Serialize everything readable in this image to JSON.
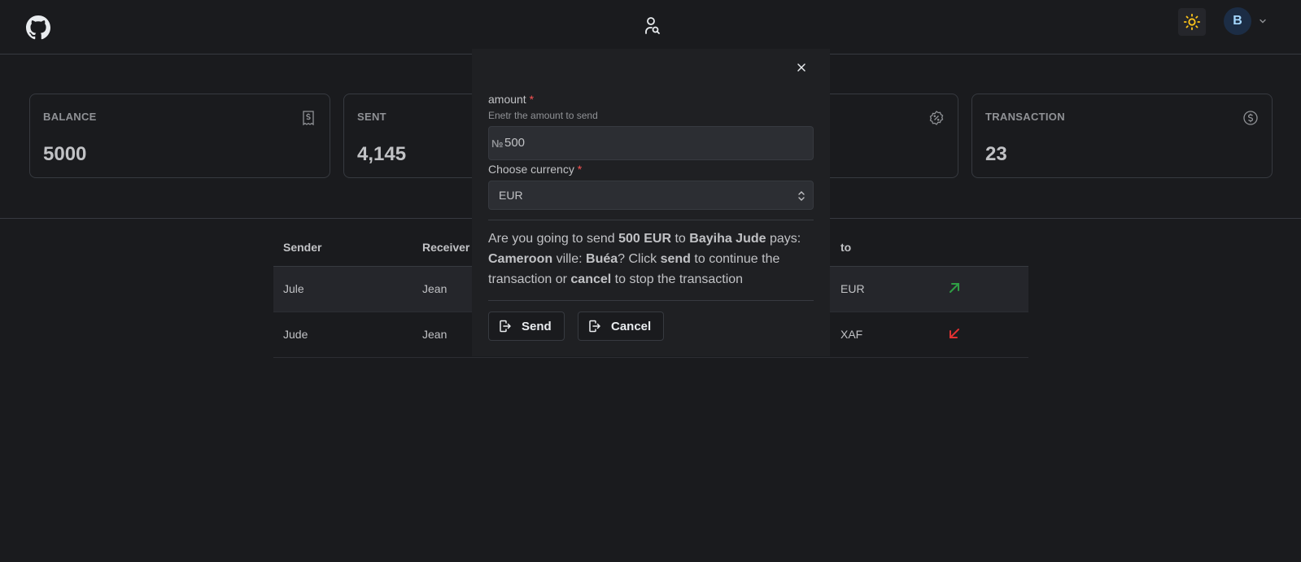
{
  "header": {
    "avatar_initial": "B"
  },
  "stats": [
    {
      "label": "BALANCE",
      "value": "5000",
      "icon": "receipt-icon"
    },
    {
      "label": "SENT",
      "value": "4,145",
      "icon": "arrow-icon"
    },
    {
      "label": "",
      "value": "",
      "icon": "discount-icon"
    },
    {
      "label": "TRANSACTION",
      "value": "23",
      "icon": "coin-icon"
    }
  ],
  "table": {
    "headers": {
      "sender": "Sender",
      "receiver": "Receiver",
      "to": "to"
    },
    "rows": [
      {
        "sender": "Jule",
        "receiver": "Jean",
        "to": "EUR",
        "direction": "up-right",
        "direction_color": "#2f9e44"
      },
      {
        "sender": "Jude",
        "receiver": "Jean",
        "to": "XAF",
        "direction": "down-left",
        "direction_color": "#e03131"
      }
    ]
  },
  "modal": {
    "amount_label": "amount",
    "required_mark": "*",
    "amount_description": "Enetr the amount to send",
    "amount_prefix": "№",
    "amount_value": "500",
    "currency_label": "Choose currency",
    "currency_value": "EUR",
    "confirm": {
      "p1": "Are you going to send ",
      "amount": "500 EUR",
      "p2": " to ",
      "receiver": "Bayiha Jude",
      "p3": " pays: ",
      "country": "Cameroon",
      "p4": " ville: ",
      "city": "Buéa",
      "p5": "? Click ",
      "send_word": "send",
      "p6": " to continue the transaction or ",
      "cancel_word": "cancel",
      "p7": " to stop the transaction"
    },
    "send_label": "Send",
    "cancel_label": "Cancel"
  },
  "colors": {
    "background": "#1a1b1e",
    "sun": "#fcc419",
    "up_arrow": "#2f9e44",
    "down_arrow": "#e03131"
  }
}
